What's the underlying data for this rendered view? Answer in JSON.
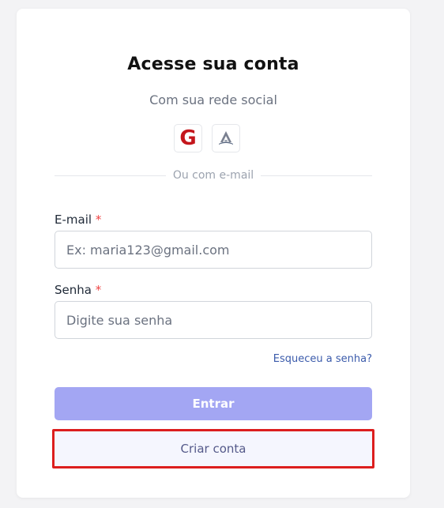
{
  "login": {
    "title": "Acesse sua conta",
    "subtitle": "Com sua rede social",
    "social": {
      "google_icon": "google-icon",
      "google_letter": "G",
      "church_icon": "church-icon"
    },
    "divider_text": "Ou com e-mail",
    "email": {
      "label": "E-mail",
      "required_mark": "*",
      "placeholder": "Ex: maria123@gmail.com",
      "value": ""
    },
    "password": {
      "label": "Senha",
      "required_mark": "*",
      "placeholder": "Digite sua senha",
      "value": ""
    },
    "forgot_link": "Esqueceu a senha?",
    "submit_label": "Entrar",
    "create_account_label": "Criar conta"
  },
  "colors": {
    "primary_button": "#a3a6f3",
    "highlight_border": "#dc1e1e",
    "link": "#3b5bab",
    "google_red": "#c4161c"
  }
}
